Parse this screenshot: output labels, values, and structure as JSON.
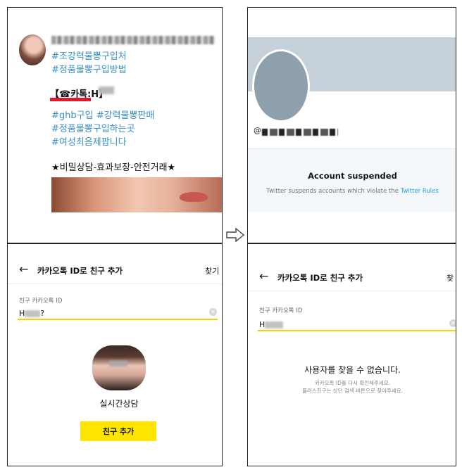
{
  "tweet": {
    "hashtags1": [
      "#조강력물뽕구입처",
      "#정품물뽕구입방법"
    ],
    "kakao_prefix": "【☎카톡:H",
    "kakao_suffix": "】",
    "hashtags2": [
      "#ghb구입 #강력물뽕판매",
      "#정품물뽕구입하는곳",
      "#여성최음제팝니다"
    ],
    "tagline": "★비밀상담-효과보장-안전거래★"
  },
  "transition_icon": "right-arrow-icon",
  "suspended": {
    "handle_prefix": "@",
    "title": "Account suspended",
    "text": "Twitter suspends accounts which violate the",
    "link": "Twitter Rules"
  },
  "kakao_found": {
    "back_icon": "back-arrow-icon",
    "title": "카카오톡 ID로 친구 추가",
    "find_label": "찾기",
    "field_label": "친구 카카오톡 ID",
    "field_value_prefix": "H",
    "field_value_suffix": "?",
    "profile_name": "실시간상담",
    "add_button": "친구 추가"
  },
  "kakao_notfound": {
    "back_icon": "back-arrow-icon",
    "title": "카카오톡 ID로 친구 추가",
    "find_label": "찾",
    "field_label": "친구 카카오톡 ID",
    "field_value_prefix": "H",
    "not_found_title": "사용자를 찾을 수 없습니다.",
    "not_found_line1": "카카오톡 ID를 다시 확인해주세요.",
    "not_found_line2": "플러스친구는 상단 검색 버튼으로 찾아주세요."
  },
  "colors": {
    "hashtag": "#3a90c8",
    "kakao_yellow": "#ffe400",
    "twitter_blue": "#1da1f2",
    "banner": "#c6d0d8"
  }
}
